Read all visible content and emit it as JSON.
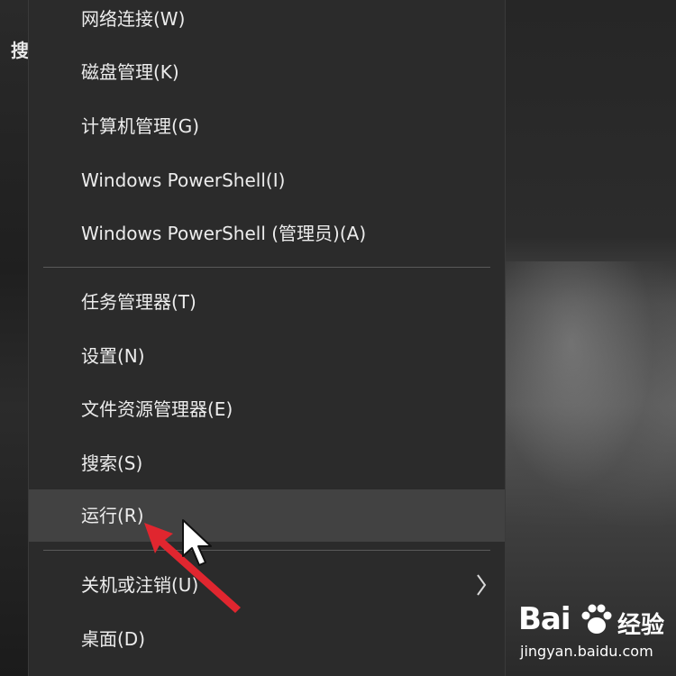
{
  "background": {
    "left_fragment": "搜"
  },
  "menu": {
    "items": [
      {
        "label": "网络连接(W)"
      },
      {
        "label": "磁盘管理(K)"
      },
      {
        "label": "计算机管理(G)"
      },
      {
        "label": "Windows PowerShell(I)"
      },
      {
        "label": "Windows PowerShell (管理员)(A)"
      },
      {
        "label": "任务管理器(T)"
      },
      {
        "label": "设置(N)"
      },
      {
        "label": "文件资源管理器(E)"
      },
      {
        "label": "搜索(S)"
      },
      {
        "label": "运行(R)",
        "highlighted": true
      },
      {
        "label": "关机或注销(U)",
        "submenu": true
      },
      {
        "label": "桌面(D)"
      }
    ]
  },
  "annotation": {
    "arrow_color": "#e0262f"
  },
  "watermark": {
    "brand": "Bai",
    "brand_suffix": "经验",
    "url": "jingyan.baidu.com"
  },
  "colors": {
    "menu_bg": "#2b2b2b",
    "highlight_bg": "#424242",
    "text": "#ececec"
  }
}
